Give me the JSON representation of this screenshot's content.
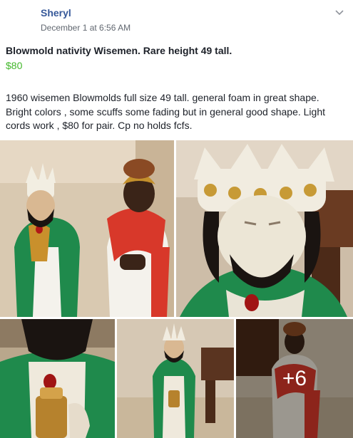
{
  "post": {
    "author": "Sheryl",
    "timestamp": "December 1 at 6:56 AM"
  },
  "listing": {
    "title": "Blowmold nativity Wisemen. Rare height 49 tall.",
    "price": "$80",
    "description": "1960 wisemen Blowmolds full size 49 tall. general foam in great shape. Bright colors , some scuffs some fading but in general good shape. Light cords work , $80 for pair. Cp no holds fcfs."
  },
  "photos": {
    "more_count": "+6"
  },
  "colors": {
    "author": "#365899",
    "price": "#42b72a",
    "timestamp": "#616770"
  },
  "icons": {
    "menu": "chevron-down-icon"
  }
}
